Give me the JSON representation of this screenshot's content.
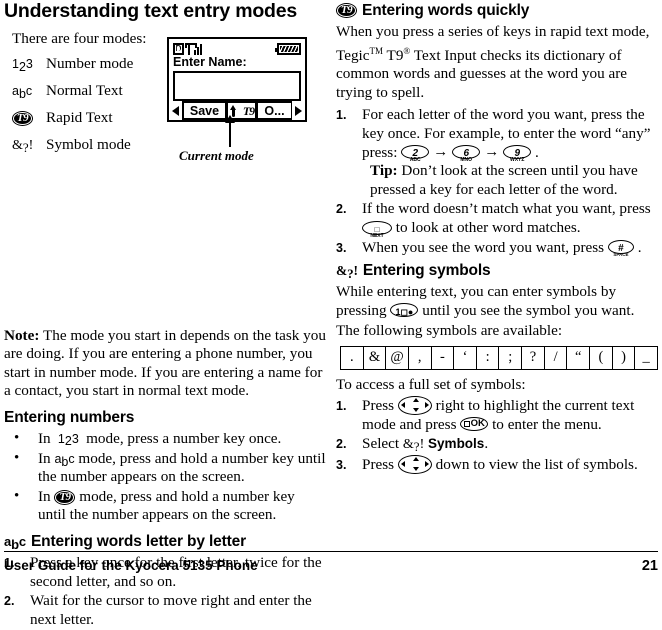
{
  "page": {
    "title": "Understanding text entry modes",
    "footer_text": "User Guide for the Kyocera 5135 Phone",
    "page_number": "21"
  },
  "left_column": {
    "modes_intro": "There are four modes:",
    "modes": [
      {
        "icon": "number-mode-icon",
        "icon_text": "123",
        "label": "Number mode"
      },
      {
        "icon": "normal-text-icon",
        "icon_text": "abc",
        "label": "Normal Text"
      },
      {
        "icon": "rapid-text-t9-icon",
        "icon_text": "T9",
        "label": "Rapid Text"
      },
      {
        "icon": "symbol-mode-icon",
        "icon_text": "&?!",
        "label": "Symbol mode"
      }
    ],
    "figure": {
      "status_digital": "D",
      "prompt": "Enter Name:",
      "input_value": "",
      "softkey_left": "Save",
      "softkey_middle_caps": "caps-arrow-glyph",
      "softkey_middle_t9": "T9",
      "softkey_right": "O...",
      "callout": "Current mode"
    },
    "note_label": "Note:",
    "note_text": " The mode you start in depends on the task you are doing. If you are entering a phone number, you start in number mode. If you are entering a name for a contact, you start in normal text mode.",
    "entering_numbers_heading": "Entering numbers",
    "number_bullets": [
      {
        "pre": "In ",
        "icon": "123",
        "post": " mode, press a number key once."
      },
      {
        "pre": "In ",
        "icon": "abc",
        "post": " mode, press and hold a number key until the number appears on the screen."
      },
      {
        "pre": "In ",
        "icon": "T9",
        "post": " mode, press and hold a number key until the number appears on the screen."
      }
    ],
    "letter_by_letter_heading": "Entering words letter by letter",
    "letter_steps": [
      "Press a key once for the first letter, twice for the second letter, and so on.",
      "Wait for the cursor to move right and enter the next letter."
    ]
  },
  "right_column": {
    "quickly_heading": "Entering words quickly",
    "quickly_intro_a": "When you press a series of keys in rapid text mode, Tegic",
    "quickly_intro_tm": "TM",
    "quickly_intro_b": " T9",
    "quickly_intro_reg": "®",
    "quickly_intro_c": " Text Input checks its dictionary of common words and guesses at the word you are trying to spell.",
    "step1_a": "For each letter of the word you want, press the key once. For example, to enter the word “any” press: ",
    "step1_keys": [
      {
        "num": "2",
        "letters": "ABC"
      },
      {
        "num": "6",
        "letters": "MNO"
      },
      {
        "num": "9",
        "letters": "WXYZ"
      }
    ],
    "step1_end": " .",
    "tip_label": "Tip:",
    "tip_text": " Don’t look at the screen until you have pressed a key for each letter of the word.",
    "step2_a": "If the word doesn’t match what you want, press ",
    "step2_key": "NEXT",
    "step2_b": " to look at other word matches.",
    "step3_a": "When you see the word you want, press ",
    "step3_key": "#",
    "step3_key_sub": "SPACE",
    "step3_b": " .",
    "symbols_heading": "Entering symbols",
    "symbols_intro_a": "While entering text, you can enter symbols by pressing ",
    "symbols_intro_key": "1",
    "symbols_intro_b": " until you see the symbol you want.",
    "symbols_available_label": "The following symbols are available:",
    "symbols": [
      ".",
      "&",
      "@",
      ",",
      "-",
      "‘",
      ":",
      ";",
      "?",
      "/",
      "“",
      "(",
      ")",
      "_"
    ],
    "full_set_label": "To access a full set of symbols:",
    "full_set_steps": [
      {
        "a": "Press ",
        "key": "nav-key",
        "b": " right to highlight the current text mode and press ",
        "key2": "OK",
        "c": " to enter the menu."
      },
      {
        "a": "Select ",
        "icon": "&?!",
        "bold": "Symbols",
        "c": "."
      },
      {
        "a": "Press ",
        "key": "nav-key",
        "b": " down to view the list of symbols."
      }
    ]
  },
  "colors": {
    "ink": "#000000",
    "paper": "#ffffff"
  }
}
